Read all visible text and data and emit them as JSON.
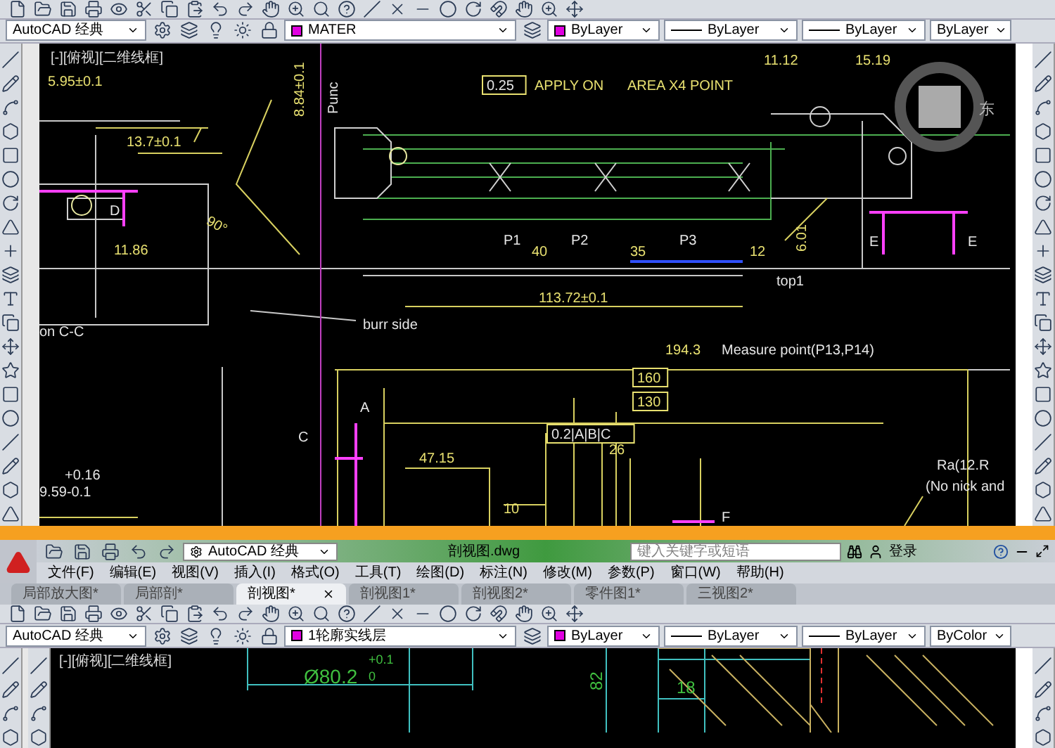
{
  "top_window": {
    "workspace_dropdown": "AutoCAD 经典",
    "layer_dropdown": "MATER",
    "color_dropdown": "ByLayer",
    "linetype_dropdown": "ByLayer",
    "lineweight_dropdown": "ByLayer",
    "plotstyle_dropdown": "ByLayer",
    "viewport_label": "[-][俯视][二维线框]",
    "viewcube_label": "东",
    "annotations": [
      {
        "text": "5.95±0.1"
      },
      {
        "text": "13.7±0.1"
      },
      {
        "text": "Punc"
      },
      {
        "text": "8.84±0.1"
      },
      {
        "text": "0.25"
      },
      {
        "text": "APPLY ON"
      },
      {
        "text": "AREA X4 POINT"
      },
      {
        "text": "11.12"
      },
      {
        "text": "15.19"
      },
      {
        "text": "P1"
      },
      {
        "text": "P2"
      },
      {
        "text": "P3"
      },
      {
        "text": "40"
      },
      {
        "text": "35"
      },
      {
        "text": "12"
      },
      {
        "text": "6.01"
      },
      {
        "text": "top1"
      },
      {
        "text": "113.72±0.1"
      },
      {
        "text": "burr side"
      },
      {
        "text": "90°"
      },
      {
        "text": "D"
      },
      {
        "text": "E"
      },
      {
        "text": "E"
      },
      {
        "text": "11.86"
      },
      {
        "text": "on C-C"
      },
      {
        "text": "194.3"
      },
      {
        "text": "Measure point(P13,P14)"
      },
      {
        "text": "160"
      },
      {
        "text": "130"
      },
      {
        "text": "A"
      },
      {
        "text": "C"
      },
      {
        "text": "0.2|A|B|C"
      },
      {
        "text": "47.15"
      },
      {
        "text": "26"
      },
      {
        "text": "+0.16"
      },
      {
        "text": "9.59-0.1"
      },
      {
        "text": "Ra(12.R"
      },
      {
        "text": "(No nick and"
      },
      {
        "text": "F"
      },
      {
        "text": "10"
      }
    ]
  },
  "bottom_window": {
    "workspace_title": "AutoCAD 经典",
    "file_title": "剖视图.dwg",
    "search": {
      "placeholder": "键入关键字或短语"
    },
    "login": "登录",
    "menus": [
      "文件(F)",
      "编辑(E)",
      "视图(V)",
      "插入(I)",
      "格式(O)",
      "工具(T)",
      "绘图(D)",
      "标注(N)",
      "修改(M)",
      "参数(P)",
      "窗口(W)",
      "帮助(H)"
    ],
    "tabs": [
      {
        "label": "局部放大图*",
        "selected": false
      },
      {
        "label": "局部剖*",
        "selected": false
      },
      {
        "label": "剖视图*",
        "selected": true
      },
      {
        "label": "剖视图1*",
        "selected": false
      },
      {
        "label": "剖视图2*",
        "selected": false
      },
      {
        "label": "零件图1*",
        "selected": false
      },
      {
        "label": "三视图2*",
        "selected": false
      }
    ],
    "workspace_dropdown": "AutoCAD 经典",
    "layer_dropdown": "1轮廓实线层",
    "color_dropdown": "ByLayer",
    "linetype_dropdown": "ByLayer",
    "lineweight_dropdown": "ByLayer",
    "plotstyle_dropdown": "ByColor",
    "viewport_label": "[-][俯视][二维线框]",
    "annotations": [
      {
        "text": "Ø80.2"
      },
      {
        "text": "+0.1"
      },
      {
        "text": "0"
      },
      {
        "text": "82"
      },
      {
        "text": "18"
      }
    ]
  }
}
